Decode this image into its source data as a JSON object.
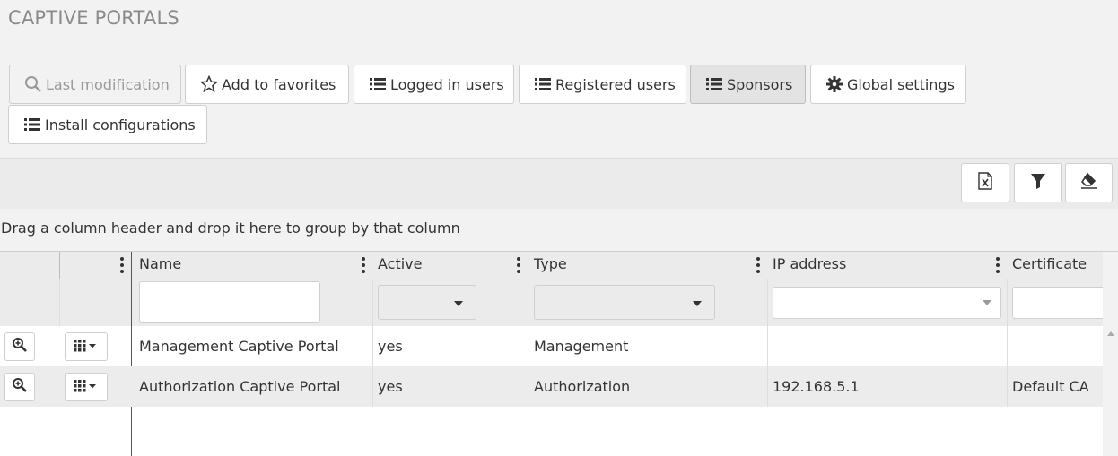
{
  "page": {
    "title": "CAPTIVE PORTALS"
  },
  "toolbar": {
    "last_modification": "Last modification",
    "add_to_favorites": "Add to favorites",
    "logged_in_users": "Logged in users",
    "registered_users": "Registered users",
    "sponsors": "Sponsors",
    "global_settings": "Global settings",
    "install_configurations": "Install configurations"
  },
  "grid_tools": [
    "excel-export-icon",
    "filter-icon",
    "eraser-icon"
  ],
  "group_panel": {
    "text": "Drag a column header and drop it here to group by that column"
  },
  "columns": [
    "Name",
    "Active",
    "Type",
    "IP address",
    "Certificate"
  ],
  "rows": [
    {
      "name": "Management Captive Portal",
      "active": "yes",
      "type": "Management",
      "ip": "",
      "certificate": ""
    },
    {
      "name": "Authorization Captive Portal",
      "active": "yes",
      "type": "Authorization",
      "ip": "192.168.5.1",
      "certificate": "Default CA"
    }
  ],
  "colors": {
    "background": "#f2f2f2",
    "active_button": "#e3e3e3",
    "alt_row": "#ececec"
  }
}
